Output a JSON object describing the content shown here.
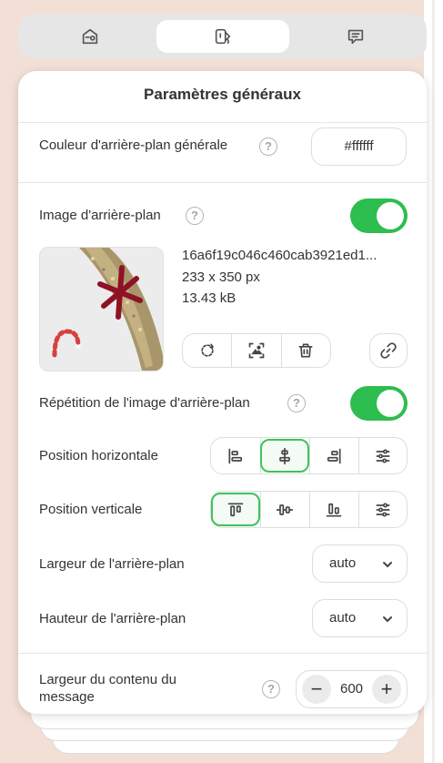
{
  "tabs": [
    {
      "icon": "settings-card-icon",
      "active": false
    },
    {
      "icon": "paint-bucket-icon",
      "active": true
    },
    {
      "icon": "message-icon",
      "active": false
    }
  ],
  "panel": {
    "title": "Paramètres généraux",
    "help_glyph": "?",
    "background_color": {
      "label": "Couleur d'arrière-plan générale",
      "value": "#ffffff"
    },
    "background_image": {
      "label": "Image d'arrière-plan",
      "enabled": true,
      "file_name": "16a6f19c046c460cab3921ed1...",
      "dimensions": "233 x 350 px",
      "file_size": "13.43 kB",
      "actions": [
        "replace-icon",
        "focal-point-icon",
        "trash-icon",
        "link-icon"
      ]
    },
    "repeat": {
      "label": "Répétition de l'image d'arrière-plan",
      "enabled": true
    },
    "horizontal_position": {
      "label": "Position horizontale",
      "options": [
        "align-left-icon",
        "align-center-horizontal-icon",
        "align-right-icon",
        "custom-sliders-icon"
      ],
      "selected_index": 1
    },
    "vertical_position": {
      "label": "Position verticale",
      "options": [
        "align-top-icon",
        "align-center-vertical-icon",
        "align-bottom-icon",
        "custom-sliders-icon"
      ],
      "selected_index": 0
    },
    "background_width": {
      "label": "Largeur de l'arrière-plan",
      "value": "auto"
    },
    "background_height": {
      "label": "Hauteur de l'arrière-plan",
      "value": "auto"
    },
    "content_width": {
      "label_line1": "Largeur du contenu du",
      "label_line2": "message",
      "value": "600",
      "minus": "−",
      "plus": "+"
    }
  },
  "colors": {
    "accent": "#2ebd4f",
    "page_background": "#f2dfd6",
    "selected_border": "#3cc45a"
  }
}
